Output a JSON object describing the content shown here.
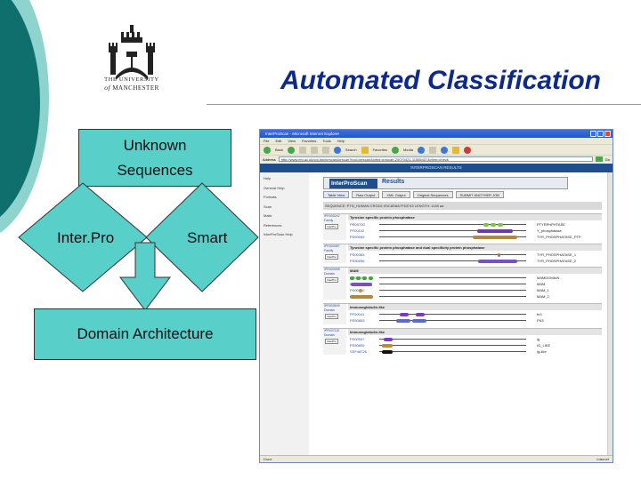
{
  "slide": {
    "title": "Automated Classification",
    "title_color": "#0d2a8a",
    "logo": {
      "line1": "THE UNIVERSITY",
      "line2_of": "of",
      "line2": "MANCHESTER"
    },
    "diagram": {
      "unknown_line1": "Unknown",
      "unknown_line2": "Sequences",
      "left_method": "Inter.Pro",
      "right_method": "Smart",
      "result": "Domain Architecture",
      "box_color": "#59cfc9"
    }
  },
  "browser": {
    "title": "InterProScan - Microsoft Internet Explorer",
    "menu": [
      "File",
      "Edit",
      "View",
      "Favorites",
      "Tools",
      "Help"
    ],
    "toolbar": {
      "back": "Back",
      "search": "Search",
      "favorites": "Favorites",
      "media": "Media"
    },
    "address_label": "Address",
    "address": "http://www.ebi.ac.uk/cgi-bin/iprscan/iprscan?tool=iprscan&jobid=iprscan-20070421-11585437&view=check",
    "go_label": "Go",
    "banner": "INTERPROSCAN RESULTS",
    "sidebar": [
      "Help",
      "General Help",
      "Formats",
      "Scan",
      "Matic",
      "References",
      "InterProScan Help"
    ],
    "header_logo": "InterProScan",
    "header_results": "Results",
    "tabs": [
      "Table View",
      "Raw Output",
      "XML Output",
      "Original Sequences",
      "SUBMIT ANOTHER JOB"
    ],
    "sequence_line": "SEQUENCE: PTN_HUMAN  CRC64: E0C8D8A7F63743 LENGTH: 1138 aa",
    "groups": [
      {
        "title": "Tyrosine specific protein phosphatase",
        "ipr": "IPR000242",
        "family": "Family",
        "rows": [
          {
            "id": "PR00700",
            "name": "PTYRPHPHTASE"
          },
          {
            "id": "PF00102",
            "name": "Y_phosphatase"
          },
          {
            "id": "PS50055",
            "name": "TYR_PHOSPHATASE_PTP"
          }
        ]
      },
      {
        "title": "Tyrosine specific protein phosphatase and dual specificity protein phosphatase",
        "ipr": "IPR000387",
        "family": "Family",
        "rows": [
          {
            "id": "PS00383",
            "name": "TYR_PHOSPHATASE_1"
          },
          {
            "id": "PS50056",
            "name": "TYR_PHOSPHATASE_2"
          }
        ]
      },
      {
        "title": "MAM",
        "ipr": "IPR000998",
        "family": "Domain",
        "rows": [
          {
            "id": "PR00020",
            "name": "MAMDOMAIN"
          },
          {
            "id": "PF00629",
            "name": "MAM"
          },
          {
            "id": "PS00740",
            "name": "MAM_1"
          },
          {
            "id": "PS50060",
            "name": "MAM_2"
          }
        ]
      },
      {
        "title": "Immunoglobulin-like",
        "ipr": "IPR003599",
        "family": "Domain",
        "rows": [
          {
            "id": "PF00041",
            "name": "fn3"
          },
          {
            "id": "PS50853",
            "name": "FN3"
          }
        ]
      },
      {
        "title": "Immunoglobulin-like",
        "ipr": "IPR007110",
        "family": "Domain",
        "rows": [
          {
            "id": "PS00047",
            "name": "ig"
          },
          {
            "id": "PS50835",
            "name": "IG_LIKE"
          },
          {
            "id": "SSF48726",
            "name": "Ig-like"
          }
        ]
      }
    ],
    "interpro_btn": "InterPro",
    "status_left": "Done",
    "status_right": "Internet"
  }
}
